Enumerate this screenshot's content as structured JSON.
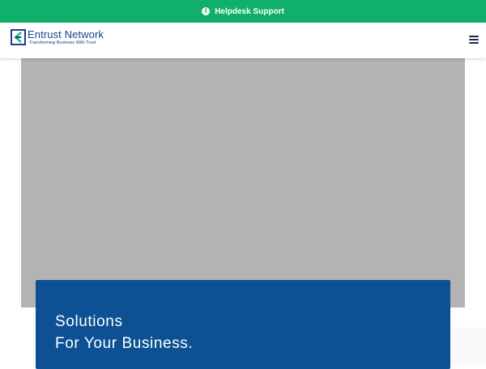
{
  "topbar": {
    "support_label": "Helpdesk Support",
    "icon": "info-icon",
    "background": "#10b06a"
  },
  "header": {
    "logo": {
      "name": "Entrust Network",
      "tagline": "Transforming Business With Trust",
      "color": "#1b3f8b"
    },
    "menu_icon": "hamburger-menu-icon"
  },
  "hero": {
    "headline_line1": "Solutions",
    "headline_line2": "For Your Business.",
    "card_color": "#0d5194"
  }
}
